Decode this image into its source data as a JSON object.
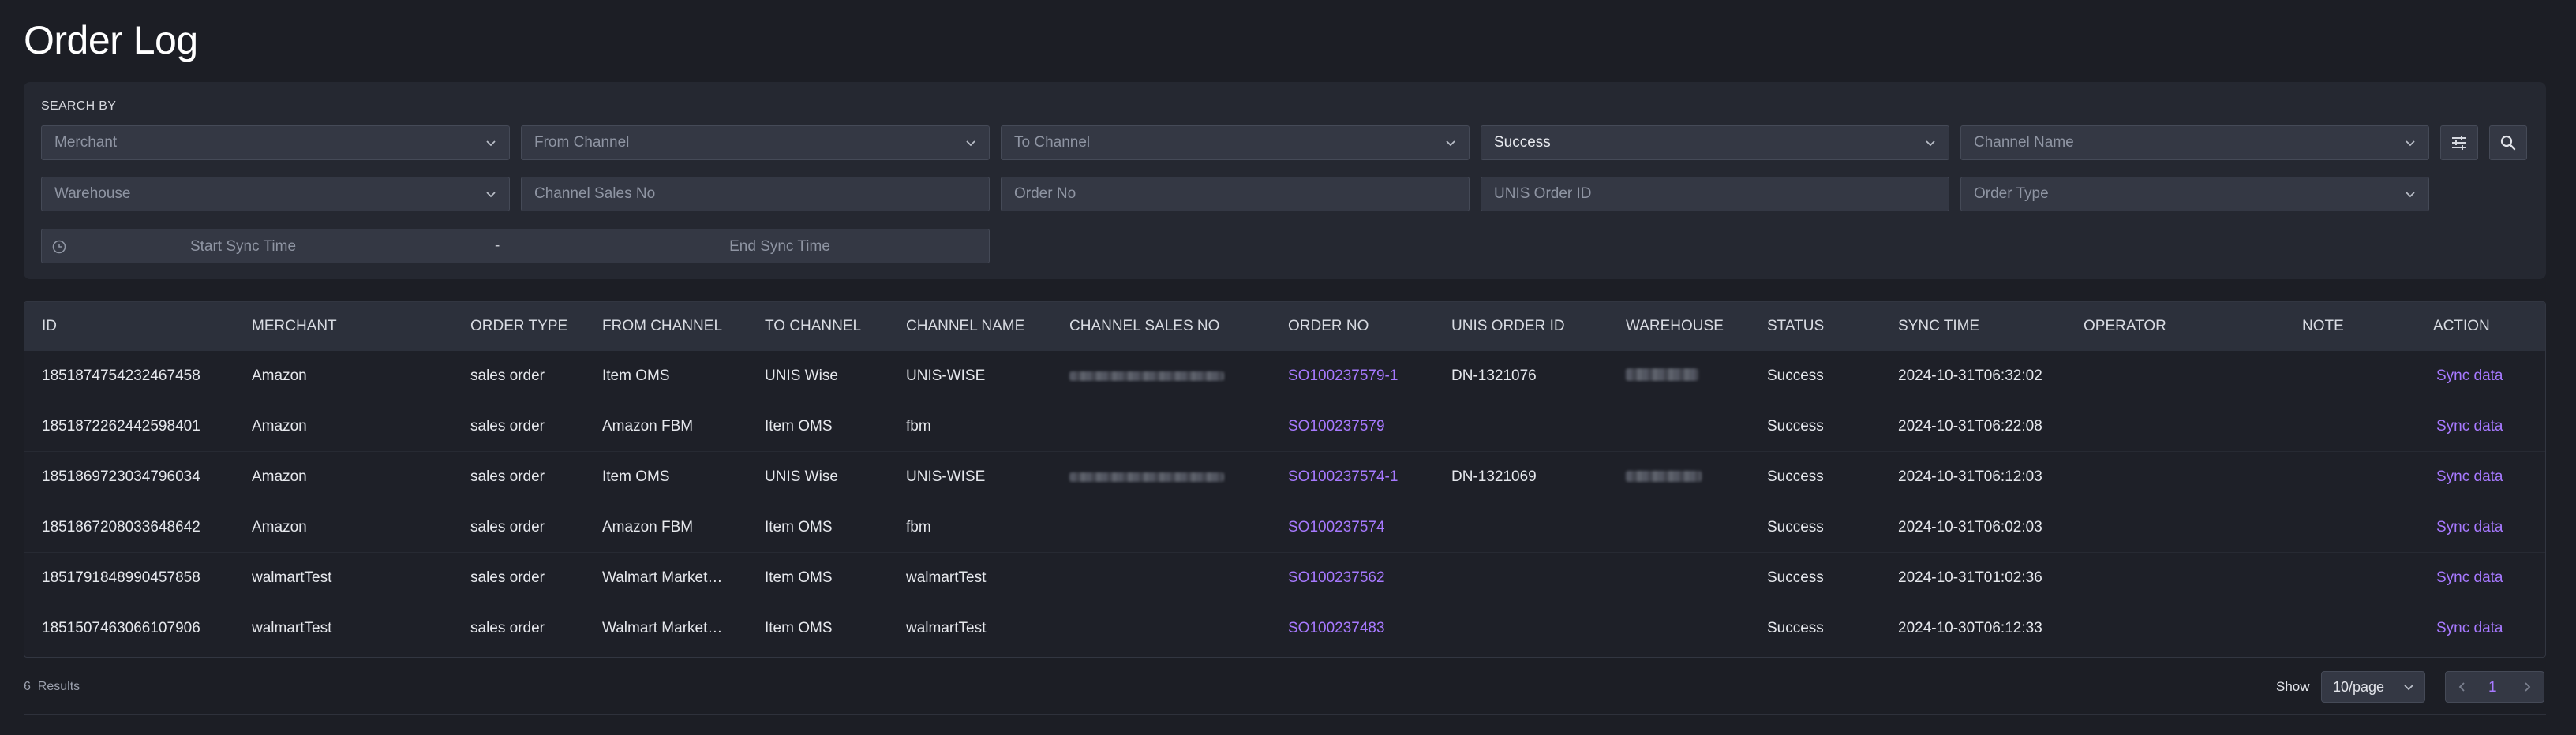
{
  "page": {
    "title": "Order Log"
  },
  "search": {
    "label": "SEARCH BY",
    "merchant_placeholder": "Merchant",
    "from_channel_placeholder": "From Channel",
    "to_channel_placeholder": "To Channel",
    "status_value": "Success",
    "channel_name_placeholder": "Channel Name",
    "warehouse_placeholder": "Warehouse",
    "channel_sales_no_placeholder": "Channel Sales No",
    "order_no_placeholder": "Order No",
    "unis_order_id_placeholder": "UNIS Order ID",
    "order_type_placeholder": "Order Type",
    "start_time_placeholder": "Start Sync Time",
    "range_separator": "-",
    "end_time_placeholder": "End Sync Time",
    "filter_icon": "sliders-icon",
    "search_icon": "search-icon"
  },
  "table": {
    "columns": [
      "ID",
      "MERCHANT",
      "ORDER TYPE",
      "FROM CHANNEL",
      "TO CHANNEL",
      "CHANNEL NAME",
      "CHANNEL SALES NO",
      "ORDER NO",
      "UNIS ORDER ID",
      "WAREHOUSE",
      "STATUS",
      "SYNC TIME",
      "OPERATOR",
      "NOTE",
      "ACTION"
    ],
    "rows": [
      {
        "id": "1851874754232467458",
        "merchant": "Amazon",
        "order_type": "sales order",
        "from_channel": "Item OMS",
        "to_channel": "UNIS Wise",
        "channel_name": "UNIS-WISE",
        "order_no": "SO100237579-1",
        "unis_order_id": "DN-1321076",
        "status": "Success",
        "sync_time": "2024-10-31T06:32:02",
        "action": "Sync data"
      },
      {
        "id": "1851872262442598401",
        "merchant": "Amazon",
        "order_type": "sales order",
        "from_channel": "Amazon FBM",
        "to_channel": "Item OMS",
        "channel_name": "fbm",
        "order_no": "SO100237579",
        "unis_order_id": "",
        "status": "Success",
        "sync_time": "2024-10-31T06:22:08",
        "action": "Sync data"
      },
      {
        "id": "1851869723034796034",
        "merchant": "Amazon",
        "order_type": "sales order",
        "from_channel": "Item OMS",
        "to_channel": "UNIS Wise",
        "channel_name": "UNIS-WISE",
        "order_no": "SO100237574-1",
        "unis_order_id": "DN-1321069",
        "status": "Success",
        "sync_time": "2024-10-31T06:12:03",
        "action": "Sync data"
      },
      {
        "id": "1851867208033648642",
        "merchant": "Amazon",
        "order_type": "sales order",
        "from_channel": "Amazon FBM",
        "to_channel": "Item OMS",
        "channel_name": "fbm",
        "order_no": "SO100237574",
        "unis_order_id": "",
        "status": "Success",
        "sync_time": "2024-10-31T06:02:03",
        "action": "Sync data"
      },
      {
        "id": "1851791848990457858",
        "merchant": "walmartTest",
        "order_type": "sales order",
        "from_channel": "Walmart Market…",
        "to_channel": "Item OMS",
        "channel_name": "walmartTest",
        "order_no": "SO100237562",
        "unis_order_id": "",
        "status": "Success",
        "sync_time": "2024-10-31T01:02:36",
        "action": "Sync data"
      },
      {
        "id": "1851507463066107906",
        "merchant": "walmartTest",
        "order_type": "sales order",
        "from_channel": "Walmart Market…",
        "to_channel": "Item OMS",
        "channel_name": "walmartTest",
        "order_no": "SO100237483",
        "unis_order_id": "",
        "status": "Success",
        "sync_time": "2024-10-30T06:12:33",
        "action": "Sync data"
      }
    ]
  },
  "footer": {
    "results_count": "6",
    "results_label": "Results",
    "show_label": "Show",
    "page_size": "10/page",
    "current_page": "1"
  },
  "colors": {
    "background": "#1c1e25",
    "panel": "#252831",
    "input": "#343844",
    "link": "#a779ff"
  }
}
